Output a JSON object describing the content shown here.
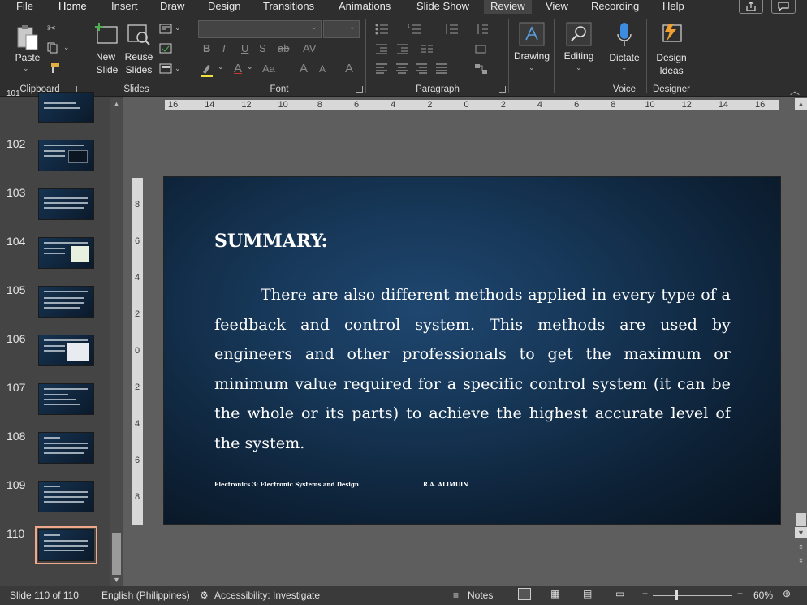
{
  "tabs": [
    "File",
    "Home",
    "Insert",
    "Draw",
    "Design",
    "Transitions",
    "Animations",
    "Slide Show",
    "Review",
    "View",
    "Recording",
    "Help"
  ],
  "ribbon": {
    "clipboard": {
      "paste": "Paste",
      "group": "Clipboard"
    },
    "slides": {
      "new_slide_1": "New",
      "new_slide_2": "Slide",
      "reuse_1": "Reuse",
      "reuse_2": "Slides",
      "group": "Slides"
    },
    "font": {
      "group": "Font",
      "bold": "B",
      "italic": "I",
      "underline": "U",
      "shadow": "S",
      "strike": "ab",
      "case": "Aa",
      "grow": "A",
      "shrink": "A"
    },
    "paragraph": {
      "group": "Paragraph"
    },
    "drawing": {
      "label": "Drawing"
    },
    "editing": {
      "label": "Editing"
    },
    "voice": {
      "dictate": "Dictate",
      "group": "Voice"
    },
    "designer": {
      "ideas_1": "Design",
      "ideas_2": "Ideas",
      "group": "Designer"
    }
  },
  "thumbnails": {
    "top_partial": "101",
    "items": [
      {
        "num": "102"
      },
      {
        "num": "103"
      },
      {
        "num": "104"
      },
      {
        "num": "105"
      },
      {
        "num": "106"
      },
      {
        "num": "107"
      },
      {
        "num": "108"
      },
      {
        "num": "109"
      },
      {
        "num": "110"
      }
    ]
  },
  "ruler": {
    "h": [
      "16",
      "14",
      "12",
      "10",
      "8",
      "6",
      "4",
      "2",
      "0",
      "2",
      "4",
      "6",
      "8",
      "10",
      "12",
      "14",
      "16"
    ],
    "v": [
      "8",
      "6",
      "4",
      "2",
      "0",
      "2",
      "4",
      "6",
      "8"
    ]
  },
  "slide": {
    "title": "SUMMARY:",
    "body": "There are also different methods applied in every type of a feedback and control system. This methods are used by engineers and other professionals to get the maximum or minimum value required for a specific control system (it can be the whole or its parts) to achieve the highest accurate level of the system.",
    "footer_left": "Electronics 3: Electronic Systems and Design",
    "footer_right": "R.A. ALIMUIN"
  },
  "status": {
    "slide": "Slide 110 of 110",
    "language": "English (Philippines)",
    "accessibility": "Accessibility: Investigate",
    "notes": "Notes",
    "zoom": "60%"
  },
  "colors": {
    "accent": "#d35230",
    "ribbon": "#2e2e2e",
    "slide_bg": "#163656"
  }
}
